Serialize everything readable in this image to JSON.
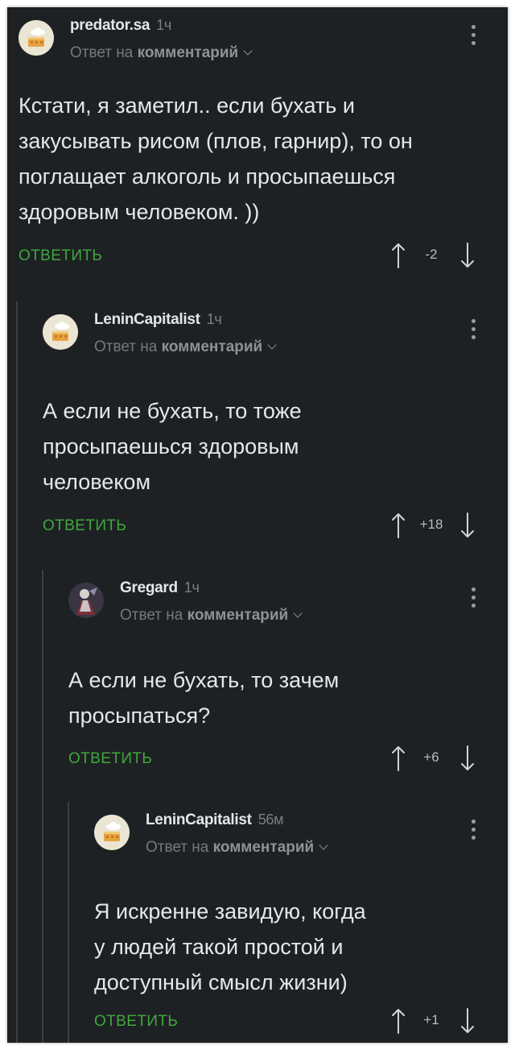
{
  "comments": [
    {
      "username": "predator.sa",
      "time": "1ч",
      "reply_prefix": "Ответ на",
      "reply_target": "комментарий",
      "text_lines": [
        "Кстати, я заметил.. если бухать и",
        "закусывать рисом (плов, гарнир), то он",
        "поглащает алкоголь и просыпаешься",
        "здоровым человеком. ))"
      ],
      "reply_label": "ОТВЕТИТЬ",
      "score": "-2",
      "avatar": "cake-avatar-icon"
    },
    {
      "username": "LeninCapitalist",
      "time": "1ч",
      "reply_prefix": "Ответ на",
      "reply_target": "комментарий",
      "text_lines": [
        "А если не бухать, то тоже",
        "просыпаешься здоровым",
        "человеком"
      ],
      "reply_label": "ОТВЕТИТЬ",
      "score": "+18",
      "avatar": "cake-avatar-icon"
    },
    {
      "username": "Gregard",
      "time": "1ч",
      "reply_prefix": "Ответ на",
      "reply_target": "комментарий",
      "text_lines": [
        "А если не бухать, то зачем",
        "просыпаться?"
      ],
      "reply_label": "ОТВЕТИТЬ",
      "score": "+6",
      "avatar": "character-avatar-icon"
    },
    {
      "username": "LeninCapitalist",
      "time": "56м",
      "reply_prefix": "Ответ на",
      "reply_target": "комментарий",
      "text_lines": [
        "Я искренне завидую, когда",
        "у людей такой простой и",
        "доступный смысл жизни)"
      ],
      "reply_label": "ОТВЕТИТЬ",
      "score": "+1",
      "avatar": "cake-avatar-icon"
    }
  ],
  "colors": {
    "background": "#1e2124",
    "reply_green": "#3fa73d",
    "text": "#e6e7e8",
    "muted": "#75797d"
  }
}
